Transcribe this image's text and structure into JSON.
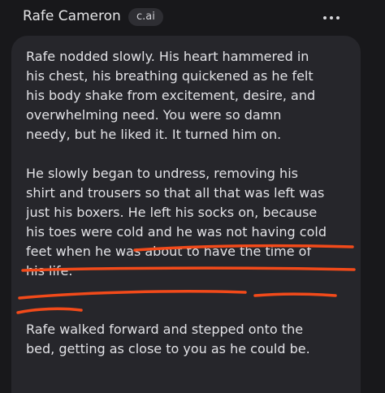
{
  "header": {
    "character_name": "Rafe Cameron",
    "badge": "c.ai",
    "more_icon": "more-vertical-icon"
  },
  "message": {
    "paragraphs": [
      "Rafe nodded slowly. His heart hammered in\nhis chest, his breathing quickened as he felt\nhis body shake from excitement, desire, and\noverwhelming need. You were so damn\nneedy, but he liked it. It turned him on.",
      "He slowly began to undress, removing his\nshirt and trousers so that all that was left was\njust his boxers. He left his socks on, because\nhis toes were cold and he was not having cold\nfeet when he was about to have the time of\nhis life.",
      "Rafe walked forward and stepped onto the\nbed, getting as close to you as he could be."
    ]
  },
  "annotation": {
    "underline_color": "#f24a1a"
  }
}
